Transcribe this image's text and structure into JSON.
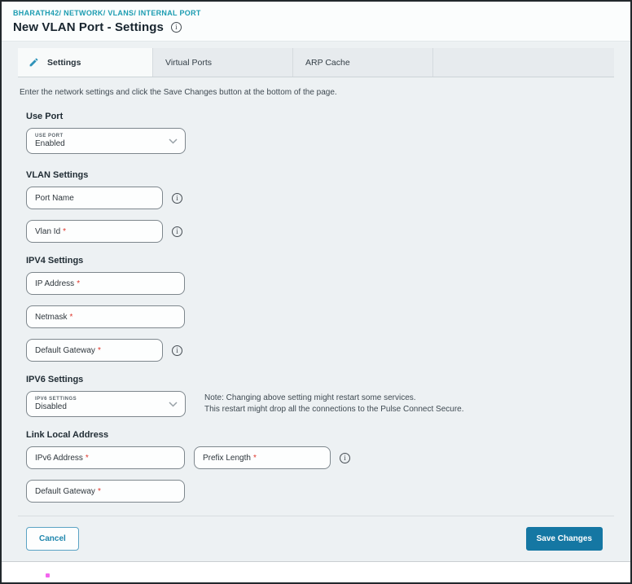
{
  "header": {
    "breadcrumb": "BHARATH42/ NETWORK/ VLANS/ INTERNAL PORT",
    "title": "New VLAN Port - Settings",
    "info_icon": "i"
  },
  "tabs": {
    "items": [
      {
        "label": "Settings",
        "active": true
      },
      {
        "label": "Virtual Ports",
        "active": false
      },
      {
        "label": "ARP Cache",
        "active": false
      }
    ]
  },
  "instruction": "Enter the network settings and click the Save Changes button at the bottom of the page.",
  "use_port": {
    "heading": "Use Port",
    "select_label": "USE PORT",
    "select_value": "Enabled"
  },
  "vlan_settings": {
    "heading": "VLAN Settings",
    "port_name": {
      "label": "Port Name",
      "star": ""
    },
    "vlan_id": {
      "label": "Vlan Id",
      "star": "*"
    }
  },
  "ipv4_settings": {
    "heading": "IPV4 Settings",
    "ip_address": {
      "label": "IP Address",
      "star": "*"
    },
    "netmask": {
      "label": "Netmask",
      "star": "*"
    },
    "default_gateway": {
      "label": "Default Gateway",
      "star": "*"
    }
  },
  "ipv6_settings": {
    "heading": "IPV6 Settings",
    "select_label": "IPV6 SETTINGS",
    "select_value": "Disabled",
    "note_line1": "Note: Changing above setting might restart some services.",
    "note_line2": "This restart might drop all the connections to the Pulse Connect Secure."
  },
  "link_local": {
    "heading": "Link Local Address",
    "ipv6_address": {
      "label": "IPv6 Address",
      "star": "*"
    },
    "prefix_length": {
      "label": "Prefix Length",
      "star": "*"
    },
    "default_gateway": {
      "label": "Default Gateway",
      "star": "*"
    }
  },
  "footer": {
    "cancel_label": "Cancel",
    "save_label": "Save Changes"
  },
  "info_glyph": "i",
  "colors": {
    "breadcrumb_teal": "#1b9cb1",
    "accent_teal": "#2f93b9",
    "save_button_blue": "#1577a3",
    "cancel_border_blue": "#5ba3c4",
    "required_red": "#df362b",
    "page_gray": "#edf1f3"
  }
}
